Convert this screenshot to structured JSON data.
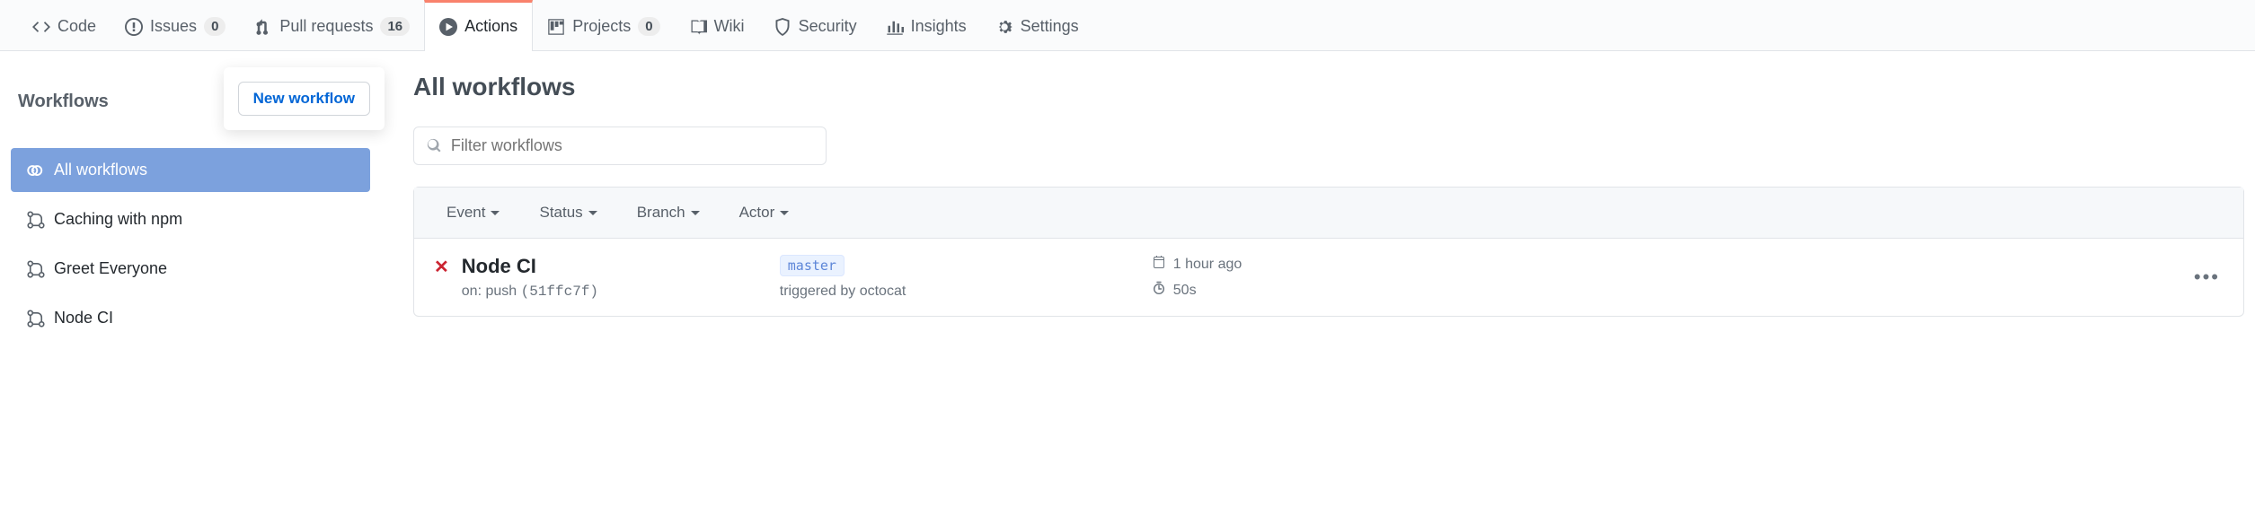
{
  "tabs": {
    "code": "Code",
    "issues": "Issues",
    "issues_count": "0",
    "pulls": "Pull requests",
    "pulls_count": "16",
    "actions": "Actions",
    "projects": "Projects",
    "projects_count": "0",
    "wiki": "Wiki",
    "security": "Security",
    "insights": "Insights",
    "settings": "Settings"
  },
  "sidebar": {
    "title": "Workflows",
    "new_button": "New workflow",
    "items": {
      "all": "All workflows",
      "w1": "Caching with npm",
      "w2": "Greet Everyone",
      "w3": "Node CI"
    }
  },
  "main": {
    "title": "All workflows",
    "filter_placeholder": "Filter workflows",
    "filters": {
      "event": "Event",
      "status": "Status",
      "branch": "Branch",
      "actor": "Actor"
    },
    "run": {
      "title": "Node CI",
      "on_prefix": "on: ",
      "event": "push",
      "hash": "(51ffc7f)",
      "branch": "master",
      "triggered_by": "triggered by octocat",
      "time_ago": "1 hour ago",
      "duration": "50s"
    }
  }
}
